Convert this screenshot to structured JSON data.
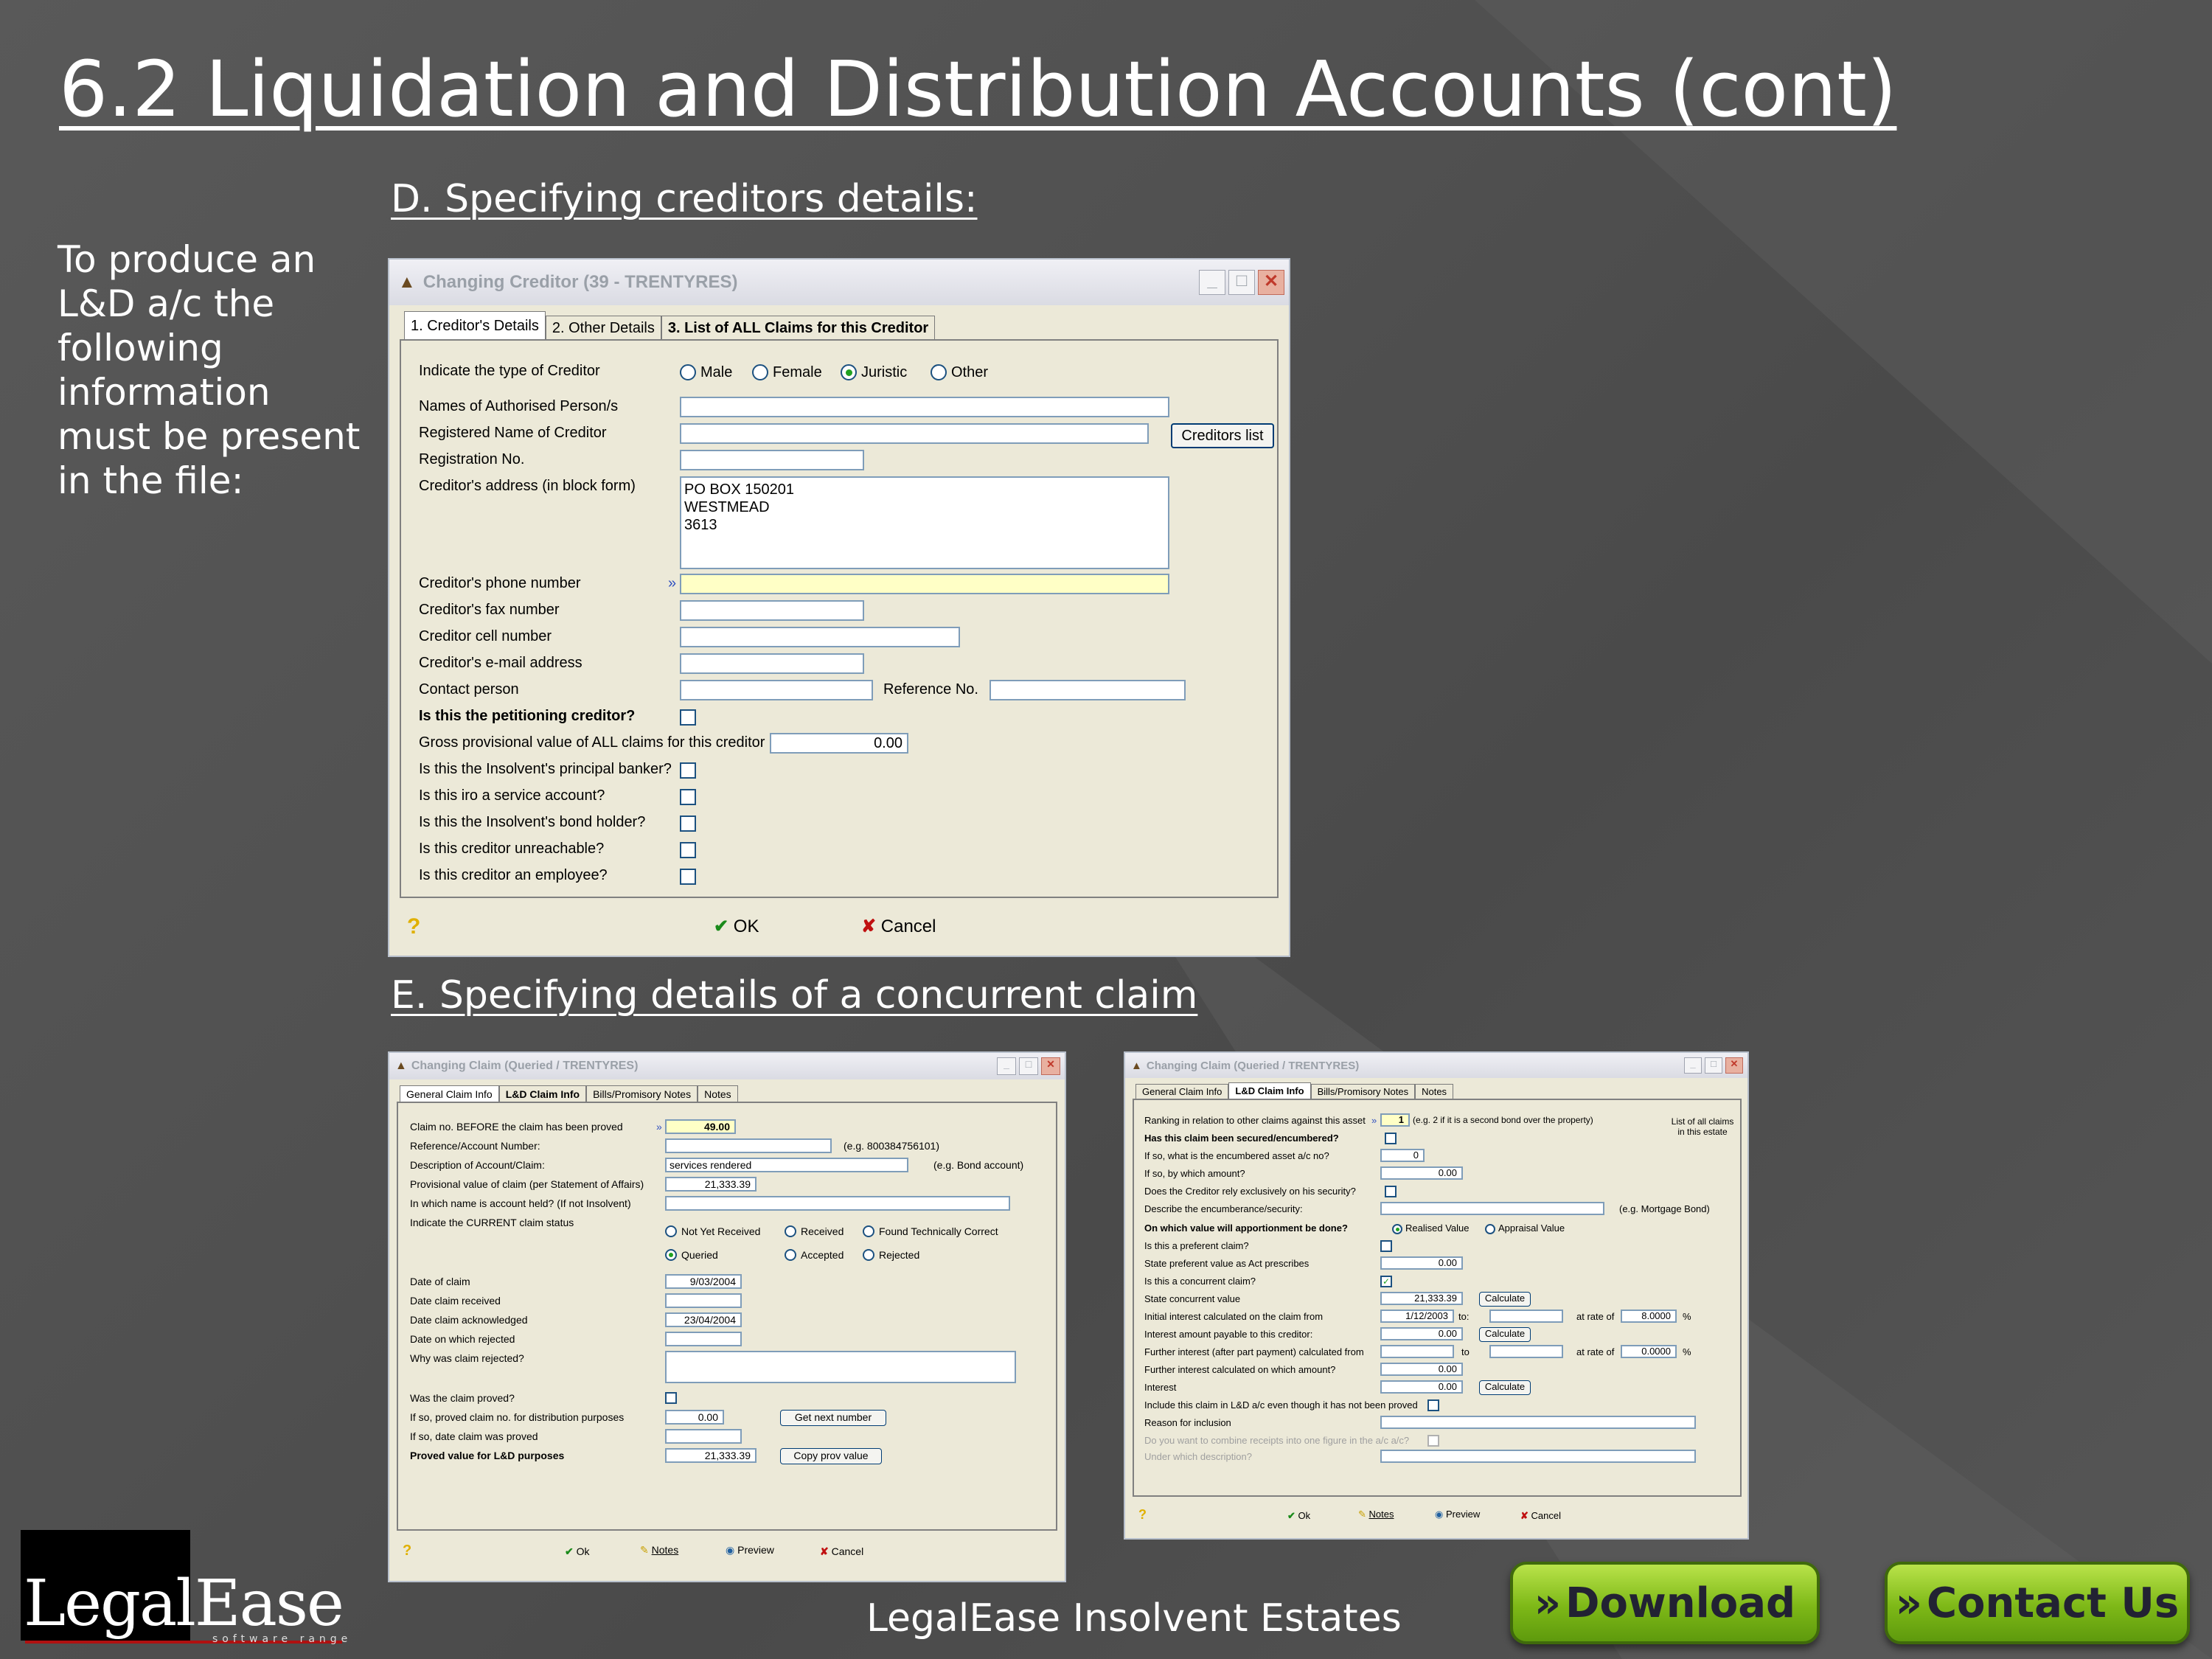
{
  "slide": {
    "title": "6.2 Liquidation and Distribution Accounts (cont)",
    "intro": "To produce an L&D a/c the following information must be present in the file:",
    "section_d": "D. Specifying creditors details:",
    "section_e": "E. Specifying details of a concurrent claim",
    "footer": "LegalEase Insolvent Estates",
    "download": "Download",
    "contact": "Contact Us",
    "logo_text": "LegalEase",
    "logo_sub": "software range"
  },
  "creditor": {
    "title": "Changing Creditor  (39 - TRENTYRES)",
    "tabs": [
      "1. Creditor's Details",
      "2. Other Details",
      "3. List of ALL Claims for this Creditor"
    ],
    "type_label": "Indicate the type of Creditor",
    "types": [
      "Male",
      "Female",
      "Juristic",
      "Other"
    ],
    "auth_label": "Names of Authorised Person/s",
    "regname_label": "Registered Name of Creditor",
    "creditors_list": "Creditors list",
    "regno_label": "Registration No.",
    "address_label": "Creditor's address (in block form)",
    "address": "PO BOX 150201\nWESTMEAD\n3613",
    "phone_label": "Creditor's phone number",
    "fax_label": "Creditor's fax number",
    "cell_label": "Creditor cell number",
    "email_label": "Creditor's e-mail address",
    "contact_label": "Contact person",
    "ref_label": "Reference No.",
    "petition_label": "Is this the petitioning creditor?",
    "gross_label": "Gross provisional value of ALL claims for this creditor",
    "gross_value": "0.00",
    "banker_label": "Is this the Insolvent's principal banker?",
    "service_label": "Is this iro a service account?",
    "bond_label": "Is this the Insolvent's bond holder?",
    "unreach_label": "Is this creditor unreachable?",
    "employee_label": "Is this creditor an employee?",
    "ok": "OK",
    "cancel": "Cancel"
  },
  "claim1": {
    "title": "Changing Claim  (Queried / TRENTYRES)",
    "tabs": [
      "General Claim Info",
      "L&D Claim Info",
      "Bills/Promisory Notes",
      "Notes"
    ],
    "claimno_label": "Claim no. BEFORE the claim has been proved",
    "claimno": "49.00",
    "ref_label": "Reference/Account Number:",
    "ref_hint": "(e.g. 800384756101)",
    "desc_label": "Description of Account/Claim:",
    "desc": "services rendered",
    "desc_hint": "(e.g. Bond account)",
    "prov_label": "Provisional value of claim (per Statement of Affairs)",
    "prov": "21,333.39",
    "name_label": "In which name is account held? (If not Insolvent)",
    "status_label": "Indicate the CURRENT claim status",
    "statuses": [
      "Not Yet Received",
      "Received",
      "Found Technically Correct",
      "Queried",
      "Accepted",
      "Rejected"
    ],
    "date_label": "Date of claim",
    "date": "9/03/2004",
    "received_label": "Date claim received",
    "ack_label": "Date claim acknowledged",
    "ack": "23/04/2004",
    "rejected_label": "Date on which rejected",
    "why_label": "Why was claim rejected?",
    "proved_label": "Was the claim proved?",
    "provedno_label": "If so, proved claim no. for distribution purposes",
    "provedno": "0.00",
    "getnext": "Get next number",
    "proveddate_label": "If so, date claim was proved",
    "provedval_label": "Proved value for L&D purposes",
    "provedval": "21,333.39",
    "copyprov": "Copy prov value",
    "ok": "Ok",
    "notes": "Notes",
    "preview": "Preview",
    "cancel": "Cancel"
  },
  "claim2": {
    "title": "Changing Claim  (Queried / TRENTYRES)",
    "tabs": [
      "General Claim Info",
      "L&D Claim Info",
      "Bills/Promisory Notes",
      "Notes"
    ],
    "rank_label": "Ranking in relation to other claims against this asset",
    "rank": "1",
    "rank_hint": "(e.g. 2 if it is a second bond over the property)",
    "listall": "List of all claims in this estate",
    "secured_label": "Has this claim been secured/encumbered?",
    "encac_label": "If so, what is the encumbered asset a/c no?",
    "encac": "0",
    "amount_label": "If so, by which amount?",
    "amount": "0.00",
    "rely_label": "Does the Creditor rely exclusively on his security?",
    "describe_label": "Describe the encumberance/security:",
    "describe_hint": "(e.g. Mortgage Bond)",
    "apport_label": "On which value will apportionment be done?",
    "apport_opts": [
      "Realised Value",
      "Appraisal Value"
    ],
    "pref_label": "Is this a preferent claim?",
    "prefval_label": "State preferent value as Act prescribes",
    "prefval": "0.00",
    "conc_label": "Is this a concurrent claim?",
    "concval_label": "State concurrent value",
    "concval": "21,333.39",
    "calculate": "Calculate",
    "initint_label": "Initial interest calculated on the claim from",
    "initint_from": "1/12/2003",
    "to": "to:",
    "to2": "to",
    "rate_label": "at rate of",
    "rate1": "8.0000",
    "pct": "%",
    "intpay_label": "Interest amount payable to this creditor:",
    "intpay": "0.00",
    "further_label": "Further interest (after part payment) calculated from",
    "rate2": "0.0000",
    "furtheramt_label": "Further interest calculated on which amount?",
    "furtheramt": "0.00",
    "interest_label": "Interest",
    "interest": "0.00",
    "include_label": "Include this claim in L&D a/c even though it has not been proved",
    "reason_label": "Reason for inclusion",
    "combine_label": "Do you want to combine receipts into one figure in the a/c a/c?",
    "under_label": "Under which description?",
    "ok": "Ok",
    "notes": "Notes",
    "preview": "Preview",
    "cancel": "Cancel"
  }
}
